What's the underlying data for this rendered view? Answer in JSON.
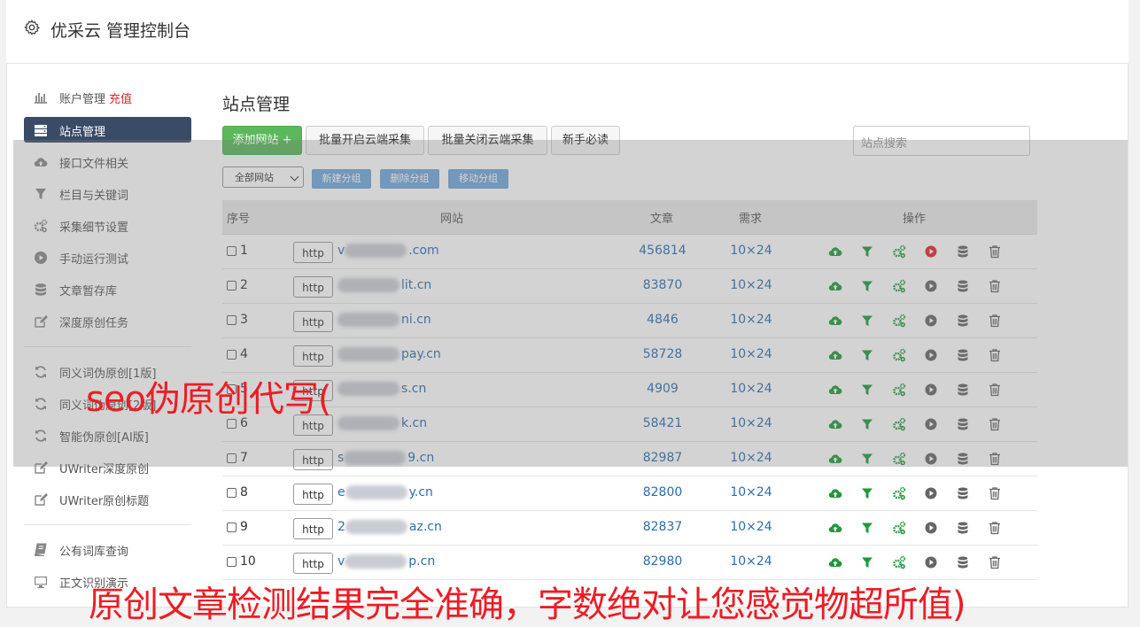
{
  "app": {
    "title": "优采云 管理控制台",
    "icon": "gear-icon"
  },
  "sidebar": {
    "items": [
      {
        "label": "账户管理",
        "badge": "充值",
        "icon": "bar-chart-icon"
      },
      {
        "label": "站点管理",
        "icon": "server-icon",
        "active": true
      },
      {
        "label": "接口文件相关",
        "icon": "cloud-upload-icon"
      },
      {
        "label": "栏目与关键词",
        "icon": "filter-icon"
      },
      {
        "label": "采集细节设置",
        "icon": "cogs-icon"
      },
      {
        "label": "手动运行测试",
        "icon": "play-circle-icon"
      },
      {
        "label": "文章暂存库",
        "icon": "database-icon"
      },
      {
        "label": "深度原创任务",
        "icon": "edit-icon"
      },
      {
        "label": "同义词伪原创[1版]",
        "icon": "refresh-icon"
      },
      {
        "label": "同义词伪原创[2版]",
        "icon": "refresh-icon"
      },
      {
        "label": "智能伪原创[AI版]",
        "icon": "refresh-icon"
      },
      {
        "label": "UWriter深度原创",
        "icon": "edit-icon"
      },
      {
        "label": "UWriter原创标题",
        "icon": "edit-icon"
      },
      {
        "label": "公有词库查询",
        "icon": "book-icon"
      },
      {
        "label": "正文识别演示",
        "icon": "monitor-icon"
      }
    ]
  },
  "main": {
    "title": "站点管理",
    "toolbar": {
      "add_site": "添加网站 +",
      "batch_open": "批量开启云端采集",
      "batch_close": "批量关闭云端采集",
      "newbie": "新手必读",
      "search_placeholder": "站点搜索"
    },
    "group_select": "全部网站",
    "group_buttons": {
      "new": "新建分组",
      "delete": "删除分组",
      "move": "移动分组"
    },
    "columns": {
      "index": "序号",
      "site": "网站",
      "articles": "文章",
      "demand": "需求",
      "ops": "操作"
    },
    "rows": [
      {
        "index": "1",
        "protocol": "http",
        "site_prefix": "v",
        "site_suffix": ".com",
        "articles": "456814",
        "demand": "10×24",
        "play_active": true
      },
      {
        "index": "2",
        "protocol": "http",
        "site_prefix": "",
        "site_suffix": "lit.cn",
        "articles": "83870",
        "demand": "10×24",
        "play_active": false
      },
      {
        "index": "3",
        "protocol": "http",
        "site_prefix": "",
        "site_suffix": "ni.cn",
        "articles": "4846",
        "demand": "10×24",
        "play_active": false
      },
      {
        "index": "4",
        "protocol": "http",
        "site_prefix": "",
        "site_suffix": "pay.cn",
        "articles": "58728",
        "demand": "10×24",
        "play_active": false
      },
      {
        "index": "5",
        "protocol": "http",
        "site_prefix": "",
        "site_suffix": "s.cn",
        "articles": "4909",
        "demand": "10×24",
        "play_active": false
      },
      {
        "index": "6",
        "protocol": "http",
        "site_prefix": "",
        "site_suffix": "k.cn",
        "articles": "58421",
        "demand": "10×24",
        "play_active": false
      },
      {
        "index": "7",
        "protocol": "http",
        "site_prefix": "s",
        "site_suffix": "9.cn",
        "articles": "82987",
        "demand": "10×24",
        "play_active": false
      },
      {
        "index": "8",
        "protocol": "http",
        "site_prefix": "e",
        "site_suffix": "y.cn",
        "articles": "82800",
        "demand": "10×24",
        "play_active": false
      },
      {
        "index": "9",
        "protocol": "http",
        "site_prefix": "2",
        "site_suffix": "az.cn",
        "articles": "82837",
        "demand": "10×24",
        "play_active": false
      },
      {
        "index": "10",
        "protocol": "http",
        "site_prefix": "v",
        "site_suffix": "p.cn",
        "articles": "82980",
        "demand": "10×24",
        "play_active": false
      }
    ]
  },
  "watermarks": {
    "line1": "seo伪原创代写(",
    "line2": "原创文章检测结果完全准确，字数绝对让您感觉物超所值)"
  },
  "colors": {
    "active_nav": "#3a4b66",
    "green": "#5cb85c",
    "blue_btn": "#6fa8dc",
    "link": "#2a6db0",
    "accent_red": "#e3262b",
    "icon_green": "#1e9a3a"
  }
}
